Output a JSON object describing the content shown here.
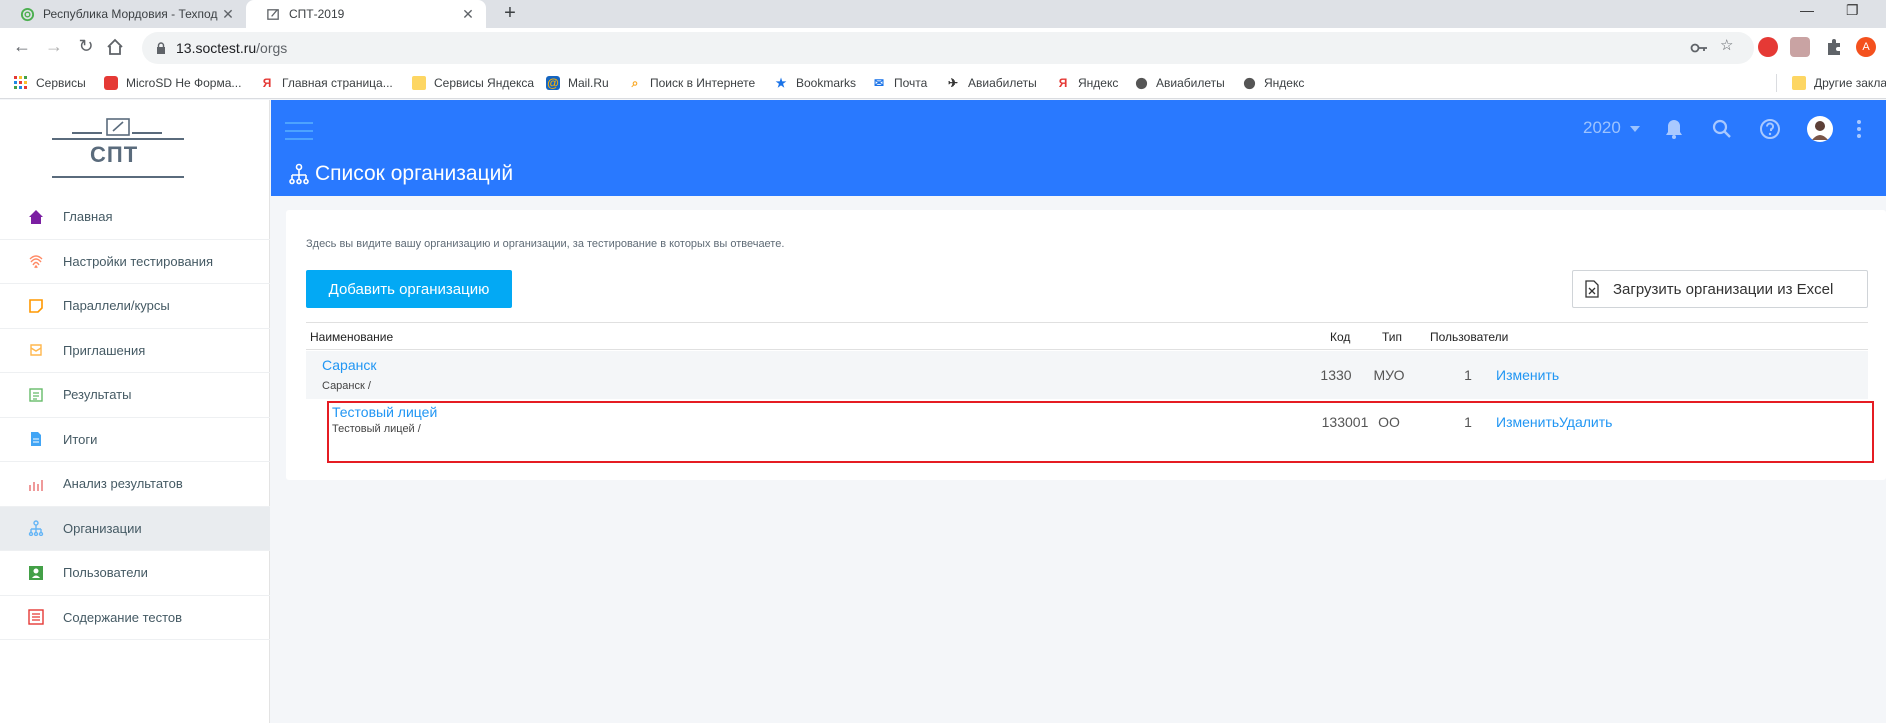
{
  "browser": {
    "tabs": [
      {
        "title": "Республика Мордовия - Техпод",
        "icon": "spiral-logo-icon"
      },
      {
        "title": "СПТ-2019",
        "icon": "edit-doc-icon"
      }
    ],
    "close_glyph": "✕",
    "newtab_glyph": "+",
    "address": {
      "host": "13.soctest.ru",
      "path": "/orgs"
    },
    "profile_letter": "A",
    "bookmarks": [
      {
        "label": "Сервисы",
        "icon": "apps-grid-icon"
      },
      {
        "label": "MicroSD Не Форма...",
        "icon": "red-app-icon"
      },
      {
        "label": "Главная страница...",
        "icon": "yandex-icon"
      },
      {
        "label": "Сервисы Яндекса",
        "icon": "folder-icon"
      },
      {
        "label": "Mail.Ru",
        "icon": "mailru-icon"
      },
      {
        "label": "Поиск в Интернете",
        "icon": "search-globe-icon"
      },
      {
        "label": "Bookmarks",
        "icon": "star-icon"
      },
      {
        "label": "Почта",
        "icon": "mail-icon"
      },
      {
        "label": "Авиабилеты",
        "icon": "plane-icon"
      },
      {
        "label": "Яндекс",
        "icon": "yandex-icon"
      },
      {
        "label": "Авиабилеты",
        "icon": "globe-icon"
      },
      {
        "label": "Яндекс",
        "icon": "globe-icon"
      },
      {
        "label": "Другие закла",
        "icon": "folder-icon"
      }
    ]
  },
  "sidebar": {
    "logo_text": "СПТ",
    "items": [
      {
        "label": "Главная",
        "icon": "home-icon",
        "color": "#7b1fa2"
      },
      {
        "label": "Настройки тестирования",
        "icon": "fingerprint-icon",
        "color": "#ff8a65"
      },
      {
        "label": "Параллели/курсы",
        "icon": "note-icon",
        "color": "#ff9800"
      },
      {
        "label": "Приглашения",
        "icon": "invite-icon",
        "color": "#ffb74d"
      },
      {
        "label": "Результаты",
        "icon": "results-icon",
        "color": "#66bb6a"
      },
      {
        "label": "Итоги",
        "icon": "document-icon",
        "color": "#42a5f5"
      },
      {
        "label": "Анализ результатов",
        "icon": "bar-chart-icon",
        "color": "#ef9a9a"
      },
      {
        "label": "Организации",
        "icon": "org-tree-icon",
        "color": "#64b5f6"
      },
      {
        "label": "Пользователи",
        "icon": "user-card-icon",
        "color": "#43a047"
      },
      {
        "label": "Содержание тестов",
        "icon": "list-icon",
        "color": "#e53935"
      }
    ],
    "active_index": 7
  },
  "header": {
    "year": "2020",
    "title": "Список организаций",
    "icons": [
      "bell-icon",
      "search-icon",
      "help-icon",
      "avatar",
      "more-vert-icon"
    ]
  },
  "main": {
    "hint": "Здесь вы видите вашу организацию и организации, за тестирование в которых вы отвечаете.",
    "add_button": "Добавить организацию",
    "excel_button": "Загрузить организации из Excel",
    "columns": {
      "name": "Наименование",
      "code": "Код",
      "type": "Тип",
      "users": "Пользователи"
    },
    "rows": [
      {
        "name": "Саранск",
        "path": "Саранск /",
        "code": "1330",
        "type": "МУО",
        "users": "1",
        "edit": "Изменить"
      },
      {
        "name": "Тестовый лицей",
        "path": "Тестовый лицей /",
        "code": "133001",
        "type": "ОО",
        "users": "1",
        "edit": "Изменить",
        "delete": "Удалить"
      }
    ]
  },
  "colors": {
    "header_blue": "#2979ff",
    "button_blue": "#03a9f4",
    "link_blue": "#2196f3",
    "highlight_red": "#e51c23"
  }
}
